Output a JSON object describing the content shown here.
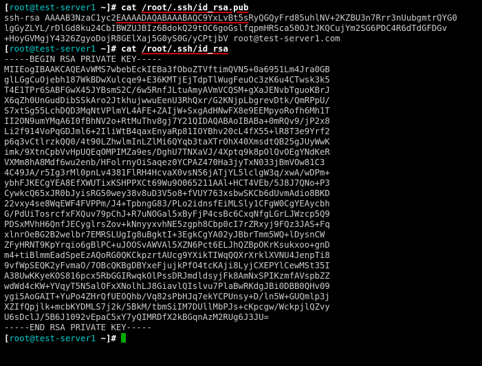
{
  "line1": {
    "prompt_open": "[",
    "user_host": "root@test-server1",
    "tilde": " ~",
    "prompt_close": "]#",
    "cmd_pre": " cat ",
    "cmd_underlined": "/root/.ssh/id_rsa.pub"
  },
  "pub_l1_a": "ssh-rsa AAAAB3NzaC1yc2",
  "pub_l1_b": "EAAAADAQABAAABAQC9YxLvBt5s",
  "pub_l1_c": "RyQGQyFrd85uhlNV+2KZBU3n7Rrr3nUubgmtrQYG0",
  "pub_l2": "lgGyZLYL/rDlGd8ku24CbIBWZUJBIz6BdokQ29tOC6goGslfqpmHRSca50OJtJKQCujYm2SG6PDC4R6dTdGFDGv",
  "pub_l3": "+HoyGVMgjY4326ZgyoDojR8GElXaj5G0yS0G/yCPtjbV root@test-server1.com",
  "line2": {
    "prompt_open": "[",
    "user_host": "root@test-server1",
    "tilde": " ~",
    "prompt_close": "]#",
    "cmd_pre": " cat ",
    "cmd_underlined": "/root/.ssh/id_rsa"
  },
  "priv_begin": "-----BEGIN RSA PRIVATE KEY-----",
  "priv_lines": [
    "MIIEogIBAAKCAQEAvWMS7wbebEckIEBa3fOboZTVftimQVN5+0a6951Lm4Jra0GB",
    "glLGgCuOjebh187WkBDwXulcqe9+E36KMTjEjTdpTlWugFeuOc3zK6u4CTwsk3k5",
    "T4E1TPr6SABFGwX45JYBsmS2C/6w5RnfJLtuAmyAVmVCQSM+gXaJENvbTguoKBrJ",
    "X6qZh0UnGudDibSSkAro2JtkhujwwuEenU3RhQxr/G2KNjpLbgrevDtk/QmRPpU/",
    "S7xtSg55LchDQD3MqNtVPlmYL4AFE+ZAIjW+SxgAdHNwFX8e9EEMpyoRofh6Mh1T",
    "II2ON9umYMqA6I0fBhNV2o+RtMuThv8gj7Y21QIDAQABAoIBABa+0mRQv9/jP2x8",
    "Li2f914VoPqGDJml6+2IliWtB4qaxEnyaRp81IOYBhv20cL4fX55+lR8T3e9Yrf2",
    "p6q3vCtlrzkQQ0/4t90LZhwlmInLZlMi6QYqb3taXTrOhX40XmsdtQB25gJUyWwK",
    "imk/9XtnCpbVvHpUQEqOMPIMZa9es/DghU7TNXaVJ/4Xptq9k8pOlQvOEgYNdKeR",
    "VXMm8hA8Mdf6wu2enb/HFolrnyOiSaqez0YCPAZ470Ha3jyTxN033jBmVOw81C3",
    "4C49JA/r5Ig3rMl0pnLv4381FlRH4HcvaX0vsN56jATjYL5lclgW3q/xwA/wDPm+",
    "ybhFJKECgYEA8EfXWUTixKSHPPXCt69Wu9O065211AAl+HCT4VEb/5J8J7QNo+P3",
    "CywkcQ65xJR0bJyisRG50wey38v8uD3V5o8+fVUY763xsbwSKCb6dUvmAdio8BKD",
    "22vxy4se8WqEWF4FVPPm/J4+TpbngG83/PLo2idnsfEiMLSly1CFgW0CgYEAycbh",
    "G/PdUiTosrcfxFXQuv79pChJ+R7uNOGal5xByFjP4csBc6CxqNfgLGrLJWzcp5Q9",
    "PDSxMVhH6QnfJECyglrsZov+kNnyyxvhNE5zgph8Cbp0cI7rZRxyj9FQz3JAS+Fq",
    "xlnrOeBG2B2welbr7EMRSLUgIg8uBgktI+3EgkCgYA02yJBbrTmm5WQ+lDysnCW",
    "ZFyHRNT9KpYrqio6gBlPC+uJOOSvAWVAl5XZN6Pct6ELJhQZBpOKrKsukxoo+gnD",
    "m4+tiBlmmEadSpeEzAQoRG0QKCkpzrtAUcg9YXikTIWqQQXrXrklXVNU4JenpTi8",
    "9vfWpSEQK2yFvmaO/7OBcQKBgDBYxeFjujkPfO4tcKAji8LyjCXEPYlCewMSt35I",
    "A38UwKKyeKOS816pcx5RbGGIRwqkOlPssDRJmdldsyjFk8AmNxSPIKzmfAVspbZZ",
    "wdWd4cKW+YVqyT5N5alOFxXNolhLJ8GiavlQIslvu7PlaBwRKdgJBi0DBB0QHv09",
    "ygi5AoGAIT+YuPo4ZHrQfUEOQhb/Vq82sPbHJq7ekYCPUnsy+D/ln5W+GUQmlp3j",
    "XZIfQpjlk+mcbKYDMLS7j2k/5BkM/tbmSiIM7DUllMbPJs+cKpcgw/WckpjlQZvy",
    "U6sDclJ/5B6J1092vEpaC5xY7yQIMRDfX2kBGqnAzM2RUg6J3JU="
  ],
  "priv_end": "-----END RSA PRIVATE KEY-----",
  "line3": {
    "prompt_open": "[",
    "user_host": "root@test-server1",
    "tilde": " ~",
    "prompt_close": "]#",
    "cmd": " "
  }
}
